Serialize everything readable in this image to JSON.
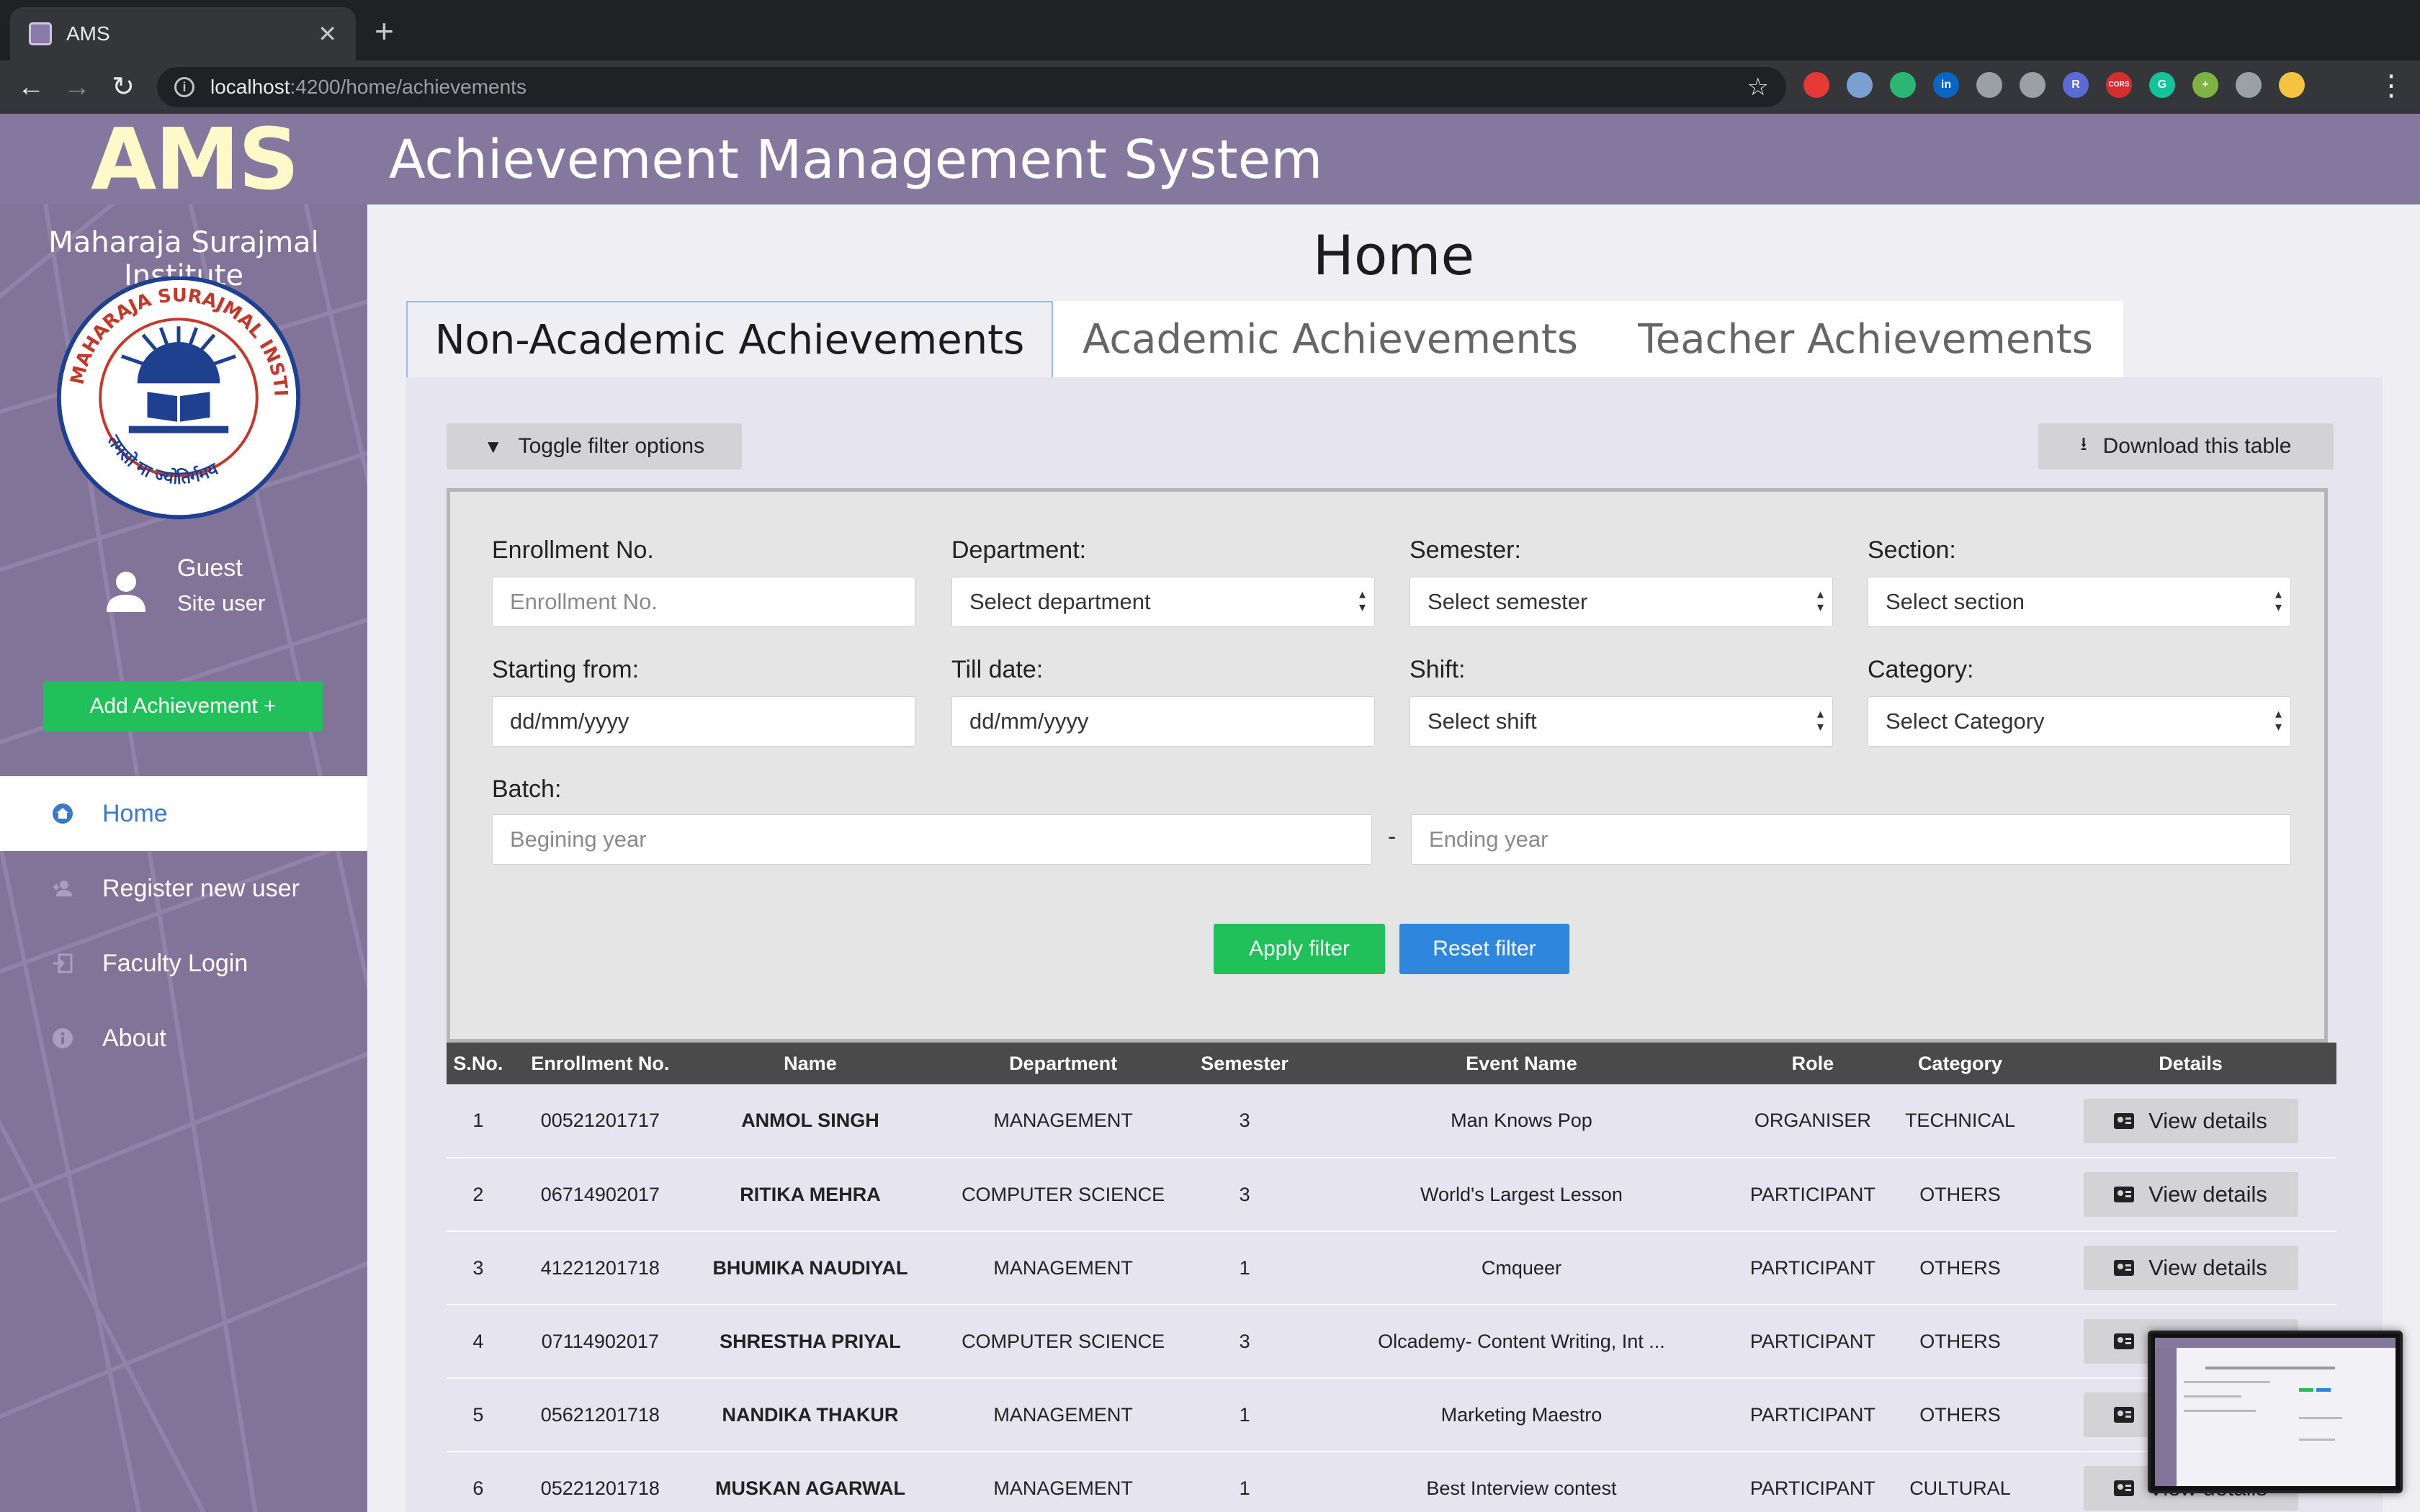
{
  "browser": {
    "tab_title": "AMS",
    "url_host": "localhost",
    "url_path": ":4200/home/achievements",
    "extensions": [
      {
        "icon": "stop-extension-icon",
        "color": "#e53935",
        "text": ""
      },
      {
        "icon": "shield-extension-icon",
        "color": "#7aa0d0",
        "text": ""
      },
      {
        "icon": "chat-extension-icon",
        "color": "#2bb673",
        "text": ""
      },
      {
        "icon": "linkedin-extension-icon",
        "color": "#0a66c2",
        "text": "in"
      },
      {
        "icon": "gear-extension-icon",
        "color": "#9aa0a6",
        "text": ""
      },
      {
        "icon": "lens-extension-icon",
        "color": "#9aa0a6",
        "text": ""
      },
      {
        "icon": "badge-extension-icon",
        "color": "#5b6bd5",
        "text": "R"
      },
      {
        "icon": "cors-extension-icon",
        "color": "#d32f2f",
        "text": "CORS"
      },
      {
        "icon": "grammarly-extension-icon",
        "color": "#15c39a",
        "text": "G"
      },
      {
        "icon": "plus-extension-icon",
        "color": "#7cb342",
        "text": "+"
      },
      {
        "icon": "calendar-extension-icon",
        "color": "#9aa0a6",
        "text": ""
      },
      {
        "icon": "profile-avatar-icon",
        "color": "#f5c242",
        "text": ""
      }
    ]
  },
  "app": {
    "logo": "AMS",
    "title": "Achievement Management System"
  },
  "sidebar": {
    "institute": "Maharaja Surajmal Institute",
    "seal_text_top": "MAHARAJA SURAJMAL INSTITUTE",
    "seal_text_bottom": "तमसो मा ज्योतिर्गमय",
    "user_name": "Guest",
    "user_role": "Site user",
    "add_button": "Add Achievement +",
    "nav": [
      {
        "label": "Home",
        "icon": "home-icon",
        "active": true
      },
      {
        "label": "Register new user",
        "icon": "add-user-icon",
        "active": false
      },
      {
        "label": "Faculty Login",
        "icon": "login-icon",
        "active": false
      },
      {
        "label": "About",
        "icon": "info-icon",
        "active": false
      }
    ]
  },
  "main": {
    "page_title": "Home",
    "tabs": [
      "Non-Academic Achievements",
      "Academic Achievements",
      "Teacher Achievements"
    ],
    "toggle_filter": "Toggle filter options",
    "download": "Download this table"
  },
  "filters": {
    "enrollment_label": "Enrollment No.",
    "enrollment_placeholder": "Enrollment No.",
    "department_label": "Department:",
    "department_value": "Select department",
    "semester_label": "Semester:",
    "semester_value": "Select semester",
    "section_label": "Section:",
    "section_value": "Select section",
    "start_label": "Starting from:",
    "start_value": "dd/mm/yyyy",
    "till_label": "Till date:",
    "till_value": "dd/mm/yyyy",
    "shift_label": "Shift:",
    "shift_value": "Select shift",
    "category_label": "Category:",
    "category_value": "Select Category",
    "batch_label": "Batch:",
    "batch_begin_placeholder": "Begining year",
    "batch_separator": "-",
    "batch_end_placeholder": "Ending year",
    "apply": "Apply filter",
    "reset": "Reset filter"
  },
  "table": {
    "headers": [
      "S.No.",
      "Enrollment No.",
      "Name",
      "Department",
      "Semester",
      "Event Name",
      "Role",
      "Category",
      "Details"
    ],
    "view_label": "View details",
    "rows": [
      {
        "sno": "1",
        "enroll": "00521201717",
        "name": "ANMOL SINGH",
        "dept": "MANAGEMENT",
        "sem": "3",
        "event": "Man Knows Pop",
        "role": "ORGANISER",
        "cat": "TECHNICAL"
      },
      {
        "sno": "2",
        "enroll": "06714902017",
        "name": "RITIKA MEHRA",
        "dept": "COMPUTER SCIENCE",
        "sem": "3",
        "event": "World's Largest Lesson",
        "role": "PARTICIPANT",
        "cat": "OTHERS"
      },
      {
        "sno": "3",
        "enroll": "41221201718",
        "name": "BHUMIKA NAUDIYAL",
        "dept": "MANAGEMENT",
        "sem": "1",
        "event": "Cmqueer",
        "role": "PARTICIPANT",
        "cat": "OTHERS"
      },
      {
        "sno": "4",
        "enroll": "07114902017",
        "name": "SHRESTHA PRIYAL",
        "dept": "COMPUTER SCIENCE",
        "sem": "3",
        "event": "Olcademy- Content Writing, Int ...",
        "role": "PARTICIPANT",
        "cat": "OTHERS"
      },
      {
        "sno": "5",
        "enroll": "05621201718",
        "name": "NANDIKA THAKUR",
        "dept": "MANAGEMENT",
        "sem": "1",
        "event": "Marketing Maestro",
        "role": "PARTICIPANT",
        "cat": "OTHERS"
      },
      {
        "sno": "6",
        "enroll": "05221201718",
        "name": "MUSKAN AGARWAL",
        "dept": "MANAGEMENT",
        "sem": "1",
        "event": "Best Interview contest",
        "role": "PARTICIPANT",
        "cat": "CULTURAL"
      }
    ]
  },
  "colors": {
    "header_bg": "#85789e",
    "sidebar_bg": "#827399",
    "logo": "#fff8c8",
    "accent_green": "#22c05a",
    "accent_blue": "#2f86dd",
    "table_header": "#4a4a4a"
  }
}
